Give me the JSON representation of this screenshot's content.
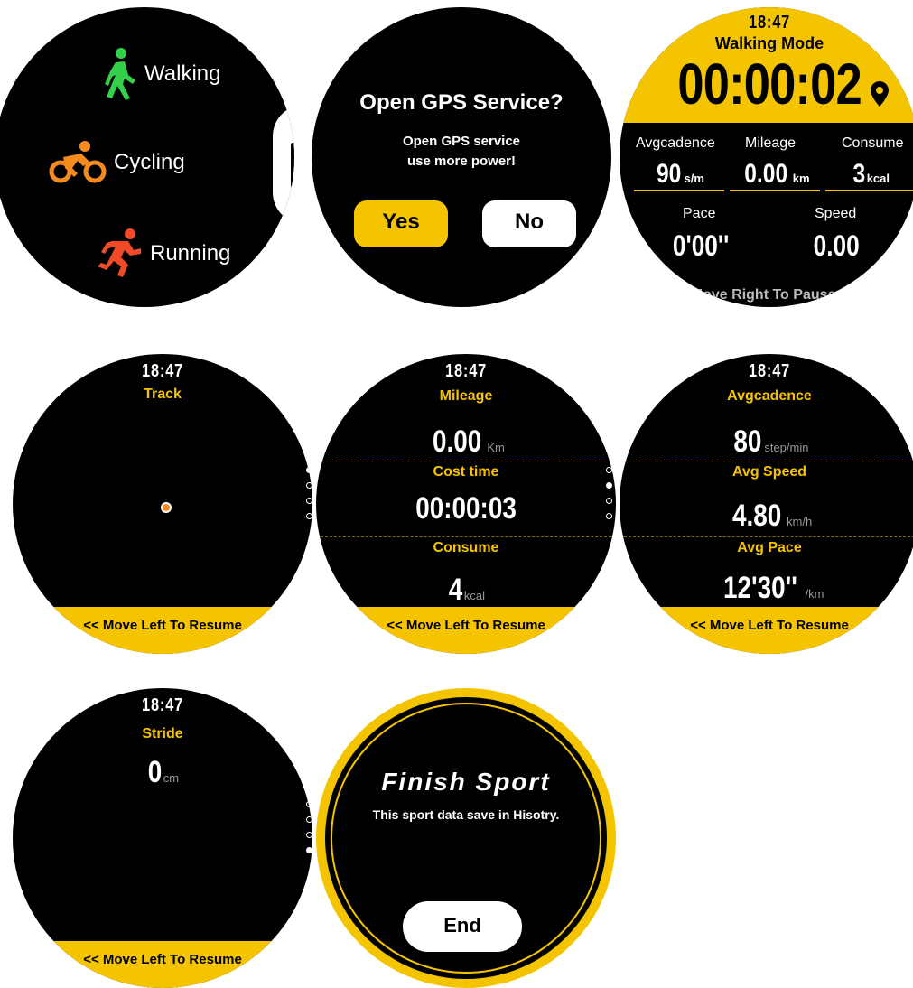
{
  "screen1": {
    "sports": [
      {
        "label": "Walking",
        "icon": "walking-icon",
        "color": "#35d049"
      },
      {
        "label": "Cycling",
        "icon": "cycling-icon",
        "color": "#f58a1f"
      },
      {
        "label": "Running",
        "icon": "running-icon",
        "color": "#f04a28"
      }
    ]
  },
  "screen2": {
    "title": "Open GPS Service?",
    "message_line1": "Open GPS service",
    "message_line2": "use more power!",
    "yes_label": "Yes",
    "no_label": "No"
  },
  "screen3": {
    "time": "18:47",
    "mode": "Walking Mode",
    "elapsed": "00:00:02",
    "stats_top": [
      {
        "label": "Avgcadence",
        "value": "90",
        "unit": "s/m"
      },
      {
        "label": "Mileage",
        "value": "0.00",
        "unit": "km"
      },
      {
        "label": "Consume",
        "value": "3",
        "unit": "kcal"
      }
    ],
    "stats_bottom": [
      {
        "label": "Pace",
        "value": "0'00''"
      },
      {
        "label": "Speed",
        "value": "0.00"
      }
    ],
    "hint": "Move Right To Pause >"
  },
  "screen4": {
    "time": "18:47",
    "title": "Track",
    "resume": "<< Move Left To Resume",
    "page_index": 0
  },
  "screen5": {
    "time": "18:47",
    "rows": [
      {
        "label": "Mileage",
        "value": "0.00",
        "unit": "Km"
      },
      {
        "label": "Cost time",
        "value": "00:00:03",
        "unit": ""
      },
      {
        "label": "Consume",
        "value": "4",
        "unit": "kcal"
      }
    ],
    "resume": "<< Move Left To Resume",
    "page_index": 1
  },
  "screen6": {
    "time": "18:47",
    "rows": [
      {
        "label": "Avgcadence",
        "value": "80",
        "unit": "step/min"
      },
      {
        "label": "Avg Speed",
        "value": "4.80",
        "unit": "km/h"
      },
      {
        "label": "Avg Pace",
        "value": "12'30''",
        "unit": "/km"
      }
    ],
    "resume": "<< Move Left To Resume",
    "page_index": 2
  },
  "screen7": {
    "time": "18:47",
    "title": "Stride",
    "value": "0",
    "unit": "cm",
    "resume": "<< Move Left To Resume",
    "page_index": 3
  },
  "screen8": {
    "title": "Finish Sport",
    "message": "This sport data save in Hisotry.",
    "end_label": "End"
  }
}
